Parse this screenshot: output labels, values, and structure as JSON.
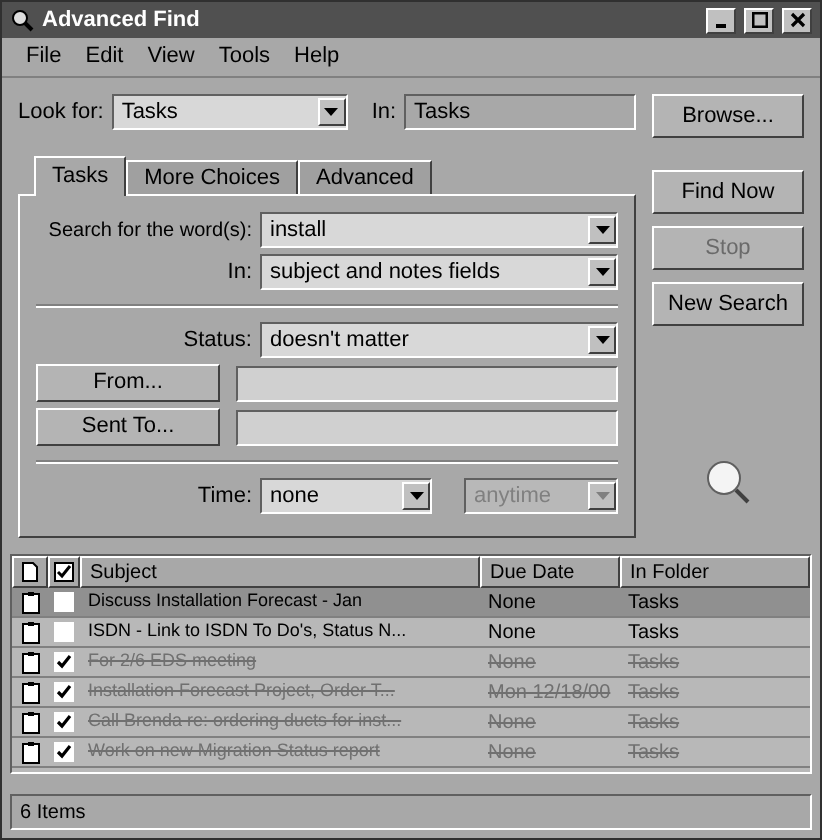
{
  "window": {
    "title": "Advanced Find"
  },
  "menu": [
    "File",
    "Edit",
    "View",
    "Tools",
    "Help"
  ],
  "look_for": {
    "label": "Look for:",
    "value": "Tasks",
    "in_label": "In:",
    "in_value": "Tasks"
  },
  "tabs": [
    {
      "label": "Tasks",
      "selected": true
    },
    {
      "label": "More Choices",
      "selected": false
    },
    {
      "label": "Advanced",
      "selected": false
    }
  ],
  "search_words": {
    "label": "Search for the word(s):",
    "value": "install"
  },
  "search_in": {
    "label": "In:",
    "value": "subject and notes fields"
  },
  "status": {
    "label": "Status:",
    "value": "doesn't matter"
  },
  "from_button": "From...",
  "sent_to_button": "Sent To...",
  "time": {
    "label": "Time:",
    "value": "none",
    "range": "anytime",
    "range_disabled": true
  },
  "buttons": [
    {
      "label": "Browse...",
      "disabled": false
    },
    {
      "label": "Find Now",
      "disabled": false
    },
    {
      "label": "Stop",
      "disabled": true
    },
    {
      "label": "New Search",
      "disabled": false
    }
  ],
  "table": {
    "columns": [
      "Subject",
      "Due Date",
      "In Folder"
    ],
    "rows": [
      {
        "subject": "Discuss Installation Forecast - Jan",
        "due": "None",
        "folder": "Tasks",
        "completed": false,
        "selected": true
      },
      {
        "subject": "ISDN - Link to ISDN To Do's, Status N...",
        "due": "None",
        "folder": "Tasks",
        "completed": false,
        "selected": false
      },
      {
        "subject": "For 2/6 EDS meeting",
        "due": "None",
        "folder": "Tasks",
        "completed": true,
        "selected": false
      },
      {
        "subject": "Installation Forecast Project, Order T...",
        "due": "Mon 12/18/00",
        "folder": "Tasks",
        "completed": true,
        "selected": false
      },
      {
        "subject": "Call Brenda re: ordering ducts for inst...",
        "due": "None",
        "folder": "Tasks",
        "completed": true,
        "selected": false
      },
      {
        "subject": "Work on new Migration Status report",
        "due": "None",
        "folder": "Tasks",
        "completed": true,
        "selected": false
      }
    ]
  },
  "status_bar": "6 Items"
}
